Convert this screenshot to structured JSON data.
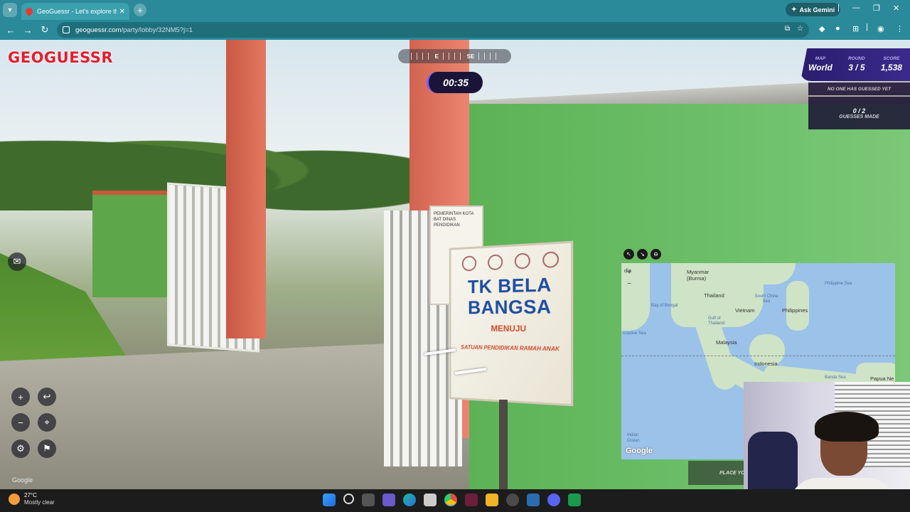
{
  "browser": {
    "tab_title": "GeoGuessr - Let's explore the w",
    "tab_close": "✕",
    "new_tab": "+",
    "ask_gemini": "Ask Gemini",
    "url_host": "geoguessr.com",
    "url_path": "/party/lobby/32NM5?j=1"
  },
  "hud": {
    "logo": "GEOGUESSR",
    "compass_left": "E",
    "compass_right": "SE",
    "timer": "00:35",
    "stats": {
      "map_label": "MAP",
      "map_value": "World",
      "round_label": "ROUND",
      "round_value": "3 / 5",
      "score_label": "SCORE",
      "score_value": "1,538"
    },
    "guess_status": "NO ONE HAS GUESSED YET",
    "guesses_count": "0 / 2",
    "guesses_label": "GUESSES MADE",
    "place_button": "PLACE YO",
    "streetview_watermark": "Google"
  },
  "scene": {
    "sign_title": "TK BELA BANGSA",
    "sign_sub": "MENUJU",
    "sign_line": "SATUAN PENDIDIKAN RAMAH ANAK",
    "small_sign": "PEMERINTAH KOTA BAT DINAS PENDIDIKAN"
  },
  "map": {
    "labels": {
      "india": "dia",
      "myanmar": "Myanmar\n(Burma)",
      "thailand": "Thailand",
      "vietnam": "Vietnam",
      "philippines": "Philippines",
      "malaysia": "Malaysia",
      "indonesia": "Indonesia",
      "papua": "Papua Ne",
      "bay_of_bengal": "Bay of Bengal",
      "south_china_sea": "South China Sea",
      "philippine_sea": "Philippine Sea",
      "gulf_thailand": "Gulf of Thailand",
      "laccadive": "ccadive Sea",
      "banda": "Banda Sea",
      "indian_ocean": "Indian Ocean"
    },
    "zoom_in": "+",
    "zoom_out": "−",
    "watermark": "Google"
  },
  "taskbar": {
    "temperature": "27°C",
    "condition": "Mostly clear"
  },
  "colors": {
    "chrome": "#2a8a9a",
    "geoguessr_red": "#e21e2f",
    "hud_purple": "#3b2a8c",
    "timer_accent": "#7b5cff"
  }
}
